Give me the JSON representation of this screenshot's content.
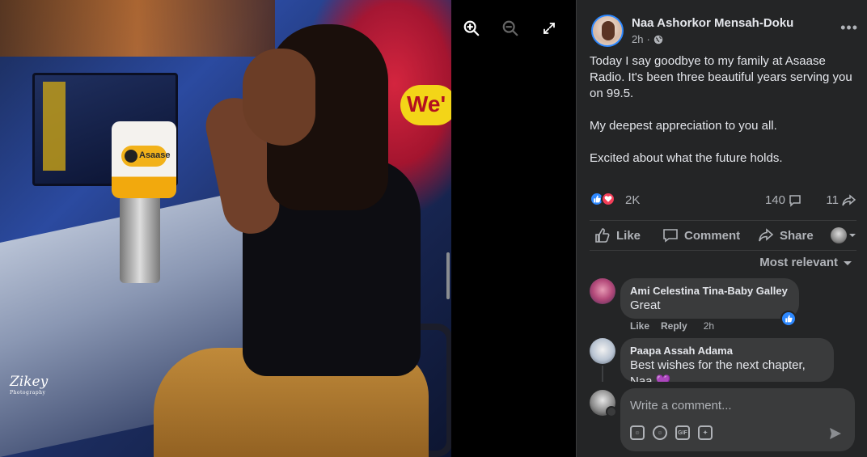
{
  "viewer": {
    "photo_watermark": "Zikey",
    "photo_watermark_sub": "Photography",
    "mic_brand": "Asaase",
    "background_sign": "We'"
  },
  "post": {
    "author": "Naa Ashorkor Mensah-Doku",
    "time": "2h",
    "audience_icon": "globe-icon",
    "paragraphs": [
      "Today I say goodbye to my family at Asaase Radio. It's been three beautiful years serving you on 99.5.",
      "My deepest appreciation to you all.",
      "Excited about what the future holds."
    ],
    "reactions_count": "2K",
    "comments_count": "140",
    "shares_count": "11"
  },
  "actions": {
    "like": "Like",
    "comment": "Comment",
    "share": "Share"
  },
  "sort_label": "Most relevant",
  "comments": [
    {
      "author": "Ami Celestina Tina-Baby Galley",
      "text": "Great",
      "like": "Like",
      "reply": "Reply",
      "time": "2h"
    },
    {
      "author": "Paapa Assah Adama",
      "text": "Best wishes for the next chapter, Naa 💜"
    }
  ],
  "composer": {
    "placeholder": "Write a comment...",
    "gif_label": "GIF"
  },
  "colors": {
    "panel_bg": "#242526",
    "bubble_bg": "#3a3b3c",
    "text_primary": "#e4e6eb",
    "text_secondary": "#b0b3b8",
    "accent_blue": "#2d88ff",
    "love_red": "#f33e58"
  }
}
